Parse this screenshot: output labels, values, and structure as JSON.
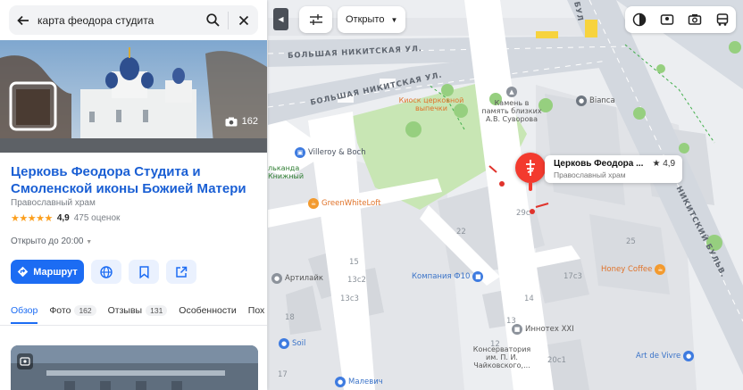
{
  "search": {
    "query": "карта феодора студита"
  },
  "place": {
    "photo_count": "162",
    "title": "Церковь Феодора Студита и Смоленской иконы Божией Матери",
    "category": "Православный храм",
    "stars": "★★★★★",
    "rating": "4,9",
    "reviews": "475 оценок",
    "hours": "Открыто до 20:00",
    "route_label": "Маршрут"
  },
  "tabs": [
    {
      "label": "Обзор",
      "count": ""
    },
    {
      "label": "Фото",
      "count": "162"
    },
    {
      "label": "Отзывы",
      "count": "131"
    },
    {
      "label": "Особенности",
      "count": ""
    },
    {
      "label": "Пох",
      "count": ""
    }
  ],
  "map_controls": {
    "collapse": "◀",
    "open_filter": "Открыто"
  },
  "map_card": {
    "name": "Церковь Феодора ...",
    "rating": "★ 4,9",
    "category": "Православный храм"
  },
  "streets": {
    "bolshaya_nikitskaya_1": "БОЛЬШАЯ НИКИТСКАЯ УЛ.",
    "bolshaya_nikitskaya_2": "БОЛЬШАЯ НИКИТСКАЯ УЛ.",
    "nikitsky_blvd": "НИКИТСКИЙ БУЛЬВ.",
    "bul": "БУЛ"
  },
  "pois": {
    "kiosk": "Киоск церковной выпечки",
    "stone": "Камень в память близких А.В. Суворова",
    "bianca": "Bianca",
    "villeroy": "Villeroy & Boch",
    "kids": "льканда Книжный",
    "greenwhite": "GreenWhiteLoft",
    "company_f10": "Компания Ф10",
    "artilayk": "Артилайк",
    "honey": "Honey Coffee",
    "innotex": "Иннотех XXI",
    "conserv": "Консерватория им. П. И. Чайковского,...",
    "soil": "Soil",
    "art_de_vivre": "Art de Vivre",
    "malevich": "Малевич"
  },
  "buildings": [
    "22",
    "29с",
    "25",
    "15",
    "13с2",
    "13с3",
    "17с3",
    "18",
    "14",
    "13",
    "12",
    "20с1",
    "17"
  ],
  "colors": {
    "accent": "#1c6cf3",
    "church_pin": "#f33a2e",
    "park": "#c8e6b4",
    "road": "#ffffff"
  }
}
